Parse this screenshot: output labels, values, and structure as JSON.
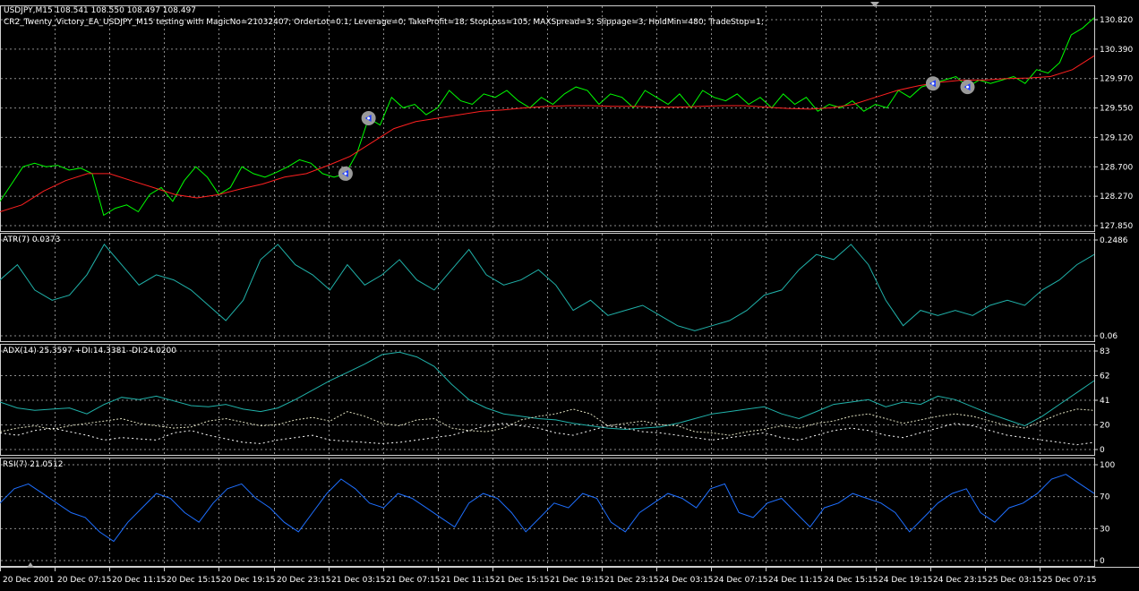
{
  "header": {
    "symbol_line": "USDJPY,M15  108.541 108.550 108.497 108.497",
    "ea_line": "CR2_Twenty_Victory_EA_USDJPY_M15 testing with MagicNo=21032407; OrderLot=0.1; Leverage=0; TakeProfit=18; StopLoss=105; MAXSpread=3; Slippage=3; HoldMin=480; TradeStop=1;"
  },
  "colors": {
    "background": "#000000",
    "price": "#00ff00",
    "ma": "#ff2020",
    "atr": "#20b2aa",
    "adx": "#20b2aa",
    "di_plus": "#e0e0c0",
    "di_minus": "#ffffff",
    "rsi": "#1e6fff",
    "grid": "#8c8c8c",
    "marker": "#9a9a9a"
  },
  "icons": {
    "trade_marker": "order-arrow-icon",
    "scroll_marker": "shift-triangle-icon"
  },
  "chart_data": [
    {
      "id": "price",
      "type": "line",
      "title": "USDJPY,M15  108.541 108.550 108.497 108.497",
      "ylim": [
        127.85,
        130.82
      ],
      "y_ticks": [
        "130.820",
        "130.390",
        "129.970",
        "129.550",
        "129.120",
        "128.700",
        "128.270",
        "127.850"
      ],
      "grid": true,
      "series": [
        {
          "values": [
            128.2,
            128.45,
            128.7,
            128.75,
            128.7,
            128.72,
            128.65,
            128.68,
            128.6,
            128.0,
            128.1,
            128.15,
            128.05,
            128.3,
            128.4,
            128.2,
            128.5,
            128.7,
            128.55,
            128.3,
            128.4,
            128.7,
            128.6,
            128.55,
            128.62,
            128.7,
            128.8,
            128.75,
            128.6,
            128.55,
            128.6,
            128.9,
            129.4,
            129.3,
            129.7,
            129.55,
            129.6,
            129.45,
            129.55,
            129.8,
            129.65,
            129.6,
            129.75,
            129.7,
            129.8,
            129.65,
            129.55,
            129.7,
            129.6,
            129.75,
            129.85,
            129.8,
            129.6,
            129.75,
            129.7,
            129.55,
            129.8,
            129.7,
            129.6,
            129.75,
            129.55,
            129.8,
            129.7,
            129.65,
            129.75,
            129.6,
            129.7,
            129.55,
            129.75,
            129.6,
            129.7,
            129.5,
            129.6,
            129.55,
            129.65,
            129.5,
            129.6,
            129.55,
            129.8,
            129.7,
            129.85,
            129.9,
            129.95,
            130.0,
            129.85,
            129.95,
            129.9,
            129.95,
            130.0,
            129.9,
            130.1,
            130.05,
            130.2,
            130.6,
            130.7,
            130.85
          ]
        },
        {
          "values": [
            128.05,
            128.15,
            128.35,
            128.5,
            128.6,
            128.6,
            128.5,
            128.4,
            128.3,
            128.25,
            128.3,
            128.38,
            128.45,
            128.55,
            128.6,
            128.72,
            128.85,
            129.05,
            129.25,
            129.35,
            129.4,
            129.45,
            129.5,
            129.52,
            129.55,
            129.57,
            129.58,
            129.58,
            129.57,
            129.57,
            129.56,
            129.56,
            129.57,
            129.58,
            129.58,
            129.56,
            129.54,
            129.53,
            129.55,
            129.6,
            129.7,
            129.8,
            129.87,
            129.92,
            129.95,
            129.95,
            129.97,
            129.98,
            130.0,
            130.1,
            130.3
          ]
        }
      ]
    },
    {
      "id": "atr",
      "type": "line",
      "title": "ATR(7) 0.0373",
      "ylim": [
        0.06,
        0.2486
      ],
      "y_ticks": [
        "0.2486",
        "0.06"
      ],
      "grid": true,
      "series": [
        {
          "values": [
            0.17,
            0.2,
            0.15,
            0.13,
            0.14,
            0.18,
            0.24,
            0.2,
            0.16,
            0.18,
            0.17,
            0.15,
            0.12,
            0.09,
            0.13,
            0.21,
            0.24,
            0.2,
            0.18,
            0.15,
            0.2,
            0.16,
            0.18,
            0.21,
            0.17,
            0.15,
            0.19,
            0.23,
            0.18,
            0.16,
            0.17,
            0.19,
            0.16,
            0.11,
            0.13,
            0.1,
            0.11,
            0.12,
            0.1,
            0.08,
            0.07,
            0.08,
            0.09,
            0.11,
            0.14,
            0.15,
            0.19,
            0.22,
            0.21,
            0.24,
            0.2,
            0.13,
            0.08,
            0.11,
            0.1,
            0.11,
            0.1,
            0.12,
            0.13,
            0.12,
            0.15,
            0.17,
            0.2,
            0.22
          ]
        }
      ]
    },
    {
      "id": "adx",
      "type": "line",
      "title": "ADX(14) 25.3597 +DI:14.3381 -DI:24.0200",
      "ylim": [
        0,
        83
      ],
      "y_ticks": [
        "83",
        "62",
        "41",
        "20",
        "0"
      ],
      "grid": true,
      "series": [
        {
          "values": [
            40,
            35,
            33,
            34,
            35,
            30,
            38,
            44,
            42,
            45,
            41,
            37,
            36,
            38,
            34,
            32,
            35,
            42,
            50,
            58,
            65,
            72,
            80,
            82,
            78,
            70,
            55,
            42,
            35,
            30,
            28,
            26,
            25,
            22,
            20,
            18,
            17,
            18,
            19,
            22,
            26,
            30,
            32,
            34,
            36,
            30,
            26,
            32,
            38,
            40,
            42,
            36,
            40,
            38,
            45,
            42,
            36,
            30,
            25,
            20,
            28,
            38,
            48,
            58
          ]
        },
        {
          "values": [
            15,
            18,
            20,
            17,
            20,
            22,
            24,
            26,
            22,
            20,
            18,
            19,
            24,
            26,
            23,
            20,
            21,
            25,
            27,
            24,
            32,
            28,
            22,
            20,
            25,
            26,
            18,
            16,
            15,
            18,
            25,
            28,
            30,
            34,
            30,
            20,
            22,
            24,
            21,
            20,
            15,
            14,
            12,
            15,
            17,
            20,
            18,
            22,
            24,
            28,
            30,
            26,
            22,
            25,
            28,
            30,
            28,
            24,
            20,
            18,
            24,
            30,
            34,
            33
          ]
        },
        {
          "values": [
            14,
            12,
            16,
            18,
            15,
            12,
            8,
            10,
            9,
            8,
            14,
            16,
            12,
            9,
            6,
            5,
            8,
            10,
            12,
            8,
            7,
            6,
            5,
            6,
            8,
            10,
            12,
            16,
            20,
            22,
            20,
            18,
            14,
            12,
            16,
            20,
            18,
            15,
            14,
            12,
            10,
            8,
            10,
            12,
            14,
            10,
            8,
            12,
            16,
            18,
            16,
            12,
            10,
            14,
            18,
            22,
            20,
            16,
            12,
            10,
            8,
            6,
            4,
            6
          ]
        }
      ]
    },
    {
      "id": "rsi",
      "type": "line",
      "title": "RSI(7) 21.0512",
      "ylim": [
        0,
        100
      ],
      "y_ticks": [
        "100",
        "70",
        "30",
        "0"
      ],
      "grid": true,
      "series": [
        {
          "values": [
            60,
            75,
            80,
            70,
            60,
            50,
            45,
            30,
            20,
            40,
            55,
            70,
            65,
            50,
            40,
            60,
            75,
            80,
            65,
            55,
            40,
            30,
            50,
            70,
            85,
            75,
            60,
            55,
            70,
            65,
            55,
            45,
            35,
            60,
            70,
            65,
            50,
            30,
            45,
            60,
            55,
            70,
            65,
            40,
            30,
            50,
            60,
            70,
            65,
            55,
            75,
            80,
            50,
            45,
            60,
            65,
            50,
            35,
            55,
            60,
            70,
            65,
            60,
            50,
            30,
            45,
            60,
            70,
            75,
            50,
            40,
            55,
            60,
            70,
            85,
            90,
            80,
            70
          ]
        }
      ]
    }
  ],
  "x_axis": {
    "labels": [
      "20 Dec 2001",
      "20 Dec 07:15",
      "20 Dec 11:15",
      "20 Dec 15:15",
      "20 Dec 19:15",
      "20 Dec 23:15",
      "21 Dec 03:15",
      "21 Dec 07:15",
      "21 Dec 11:15",
      "21 Dec 15:15",
      "21 Dec 19:15",
      "21 Dec 23:15",
      "24 Dec 03:15",
      "24 Dec 07:15",
      "24 Dec 11:15",
      "24 Dec 15:15",
      "24 Dec 19:15",
      "24 Dec 23:15",
      "25 Dec 03:15",
      "25 Dec 07:15"
    ]
  }
}
